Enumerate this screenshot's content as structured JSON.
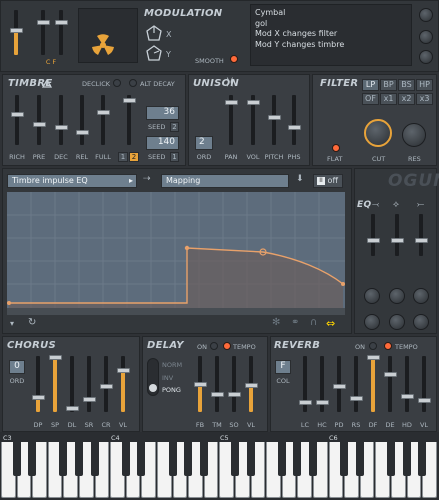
{
  "colors": {
    "accent": "#e8a33a",
    "led": "#ff6a3a",
    "bg": "#2f3236",
    "panel": "#3a3e43"
  },
  "modulation": {
    "title": "MODULATION",
    "x_label": "X",
    "y_label": "Y",
    "smooth_label": "SMOOTH",
    "cf_label": "C F"
  },
  "preset_info": {
    "lines": [
      "Cymbal",
      "gol",
      "Mod X changes filter",
      "Mod Y changes timbre"
    ]
  },
  "timbre": {
    "title": "TIMBRE",
    "declick": "DECLICK",
    "alt_decay": "ALT DECAY",
    "seed1_value": "36",
    "seed1_label": "SEED",
    "seed1_num": "2",
    "seed2_value": "140",
    "seed2_label": "SEED",
    "seed2_num": "1",
    "sliders": [
      "RICH",
      "PRE",
      "DEC",
      "REL",
      "FULL"
    ],
    "page_a": "1",
    "page_b": "2"
  },
  "unison": {
    "title": "UNISON",
    "ord_value": "2",
    "ord_label": "ORD",
    "sliders": [
      "PAN",
      "VOL",
      "PITCH",
      "PHS"
    ]
  },
  "filter": {
    "title": "FILTER",
    "types": [
      "LP",
      "BP",
      "BS",
      "HP",
      "OF",
      "x1",
      "x2",
      "x3"
    ],
    "flat": "FLAT",
    "cut": "CUT",
    "res": "RES"
  },
  "editor": {
    "source_select": "Timbre impulse EQ",
    "target_select": "Mapping",
    "off_label": "off",
    "brand": "OGUN",
    "eq_label": "EQ"
  },
  "chorus": {
    "title": "CHORUS",
    "ord_value": "0",
    "ord_label": "ORD",
    "sliders": [
      "DP",
      "SP",
      "DL",
      "SR",
      "CR",
      "VL"
    ]
  },
  "delay": {
    "title": "DELAY",
    "on": "ON",
    "tempo": "TEMPO",
    "modes": [
      "NORM",
      "INV",
      "PONG"
    ],
    "sliders": [
      "FB",
      "TM",
      "SO",
      "VL"
    ]
  },
  "reverb": {
    "title": "REVERB",
    "on": "ON",
    "tempo": "TEMPO",
    "col_value": "F",
    "col_label": "COL",
    "sliders": [
      "LC",
      "HC",
      "PD",
      "RS",
      "DF",
      "DE",
      "HD",
      "VL"
    ]
  },
  "keyboard": {
    "octaves": [
      "C3",
      "C4",
      "C5",
      "C6"
    ]
  }
}
